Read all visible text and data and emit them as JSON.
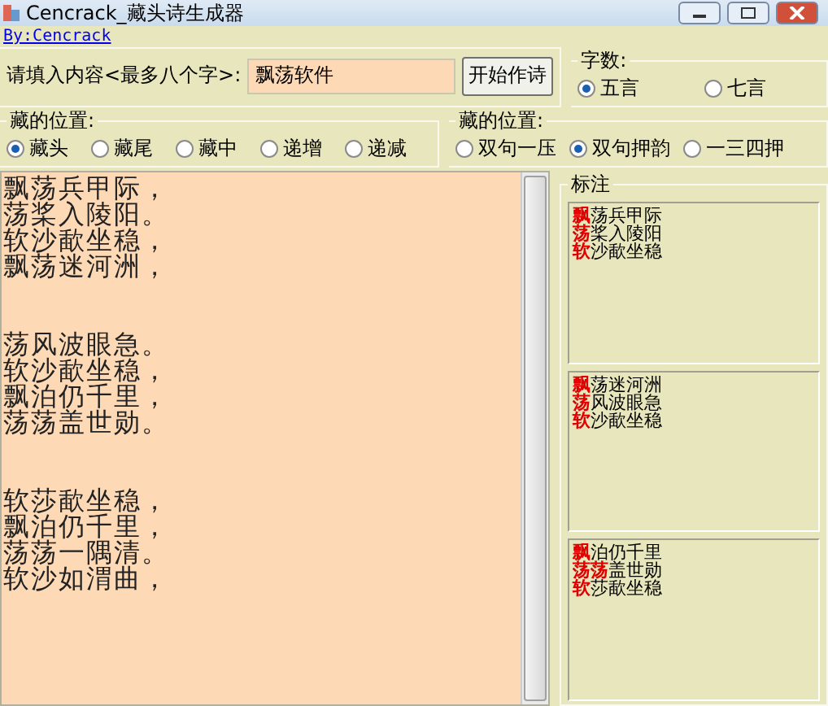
{
  "window": {
    "title": "Cencrack_藏头诗生成器"
  },
  "author_link": "By:Cencrack",
  "input": {
    "label": "请填入内容<最多八个字>:",
    "value": "飘荡软件",
    "button": "开始作诗"
  },
  "word_count": {
    "title": "字数:",
    "options": [
      {
        "label": "五言",
        "selected": true
      },
      {
        "label": "七言",
        "selected": false
      }
    ]
  },
  "position": {
    "title": "藏的位置:",
    "options": [
      {
        "label": "藏头",
        "selected": true
      },
      {
        "label": "藏尾",
        "selected": false
      },
      {
        "label": "藏中",
        "selected": false
      },
      {
        "label": "递增",
        "selected": false
      },
      {
        "label": "递减",
        "selected": false
      }
    ]
  },
  "rhyme": {
    "title": "藏的位置:",
    "options": [
      {
        "label": "双句一压",
        "selected": false
      },
      {
        "label": "双句押韵",
        "selected": true
      },
      {
        "label": "一三四押",
        "selected": false
      }
    ]
  },
  "poem": [
    [
      "飘荡兵甲际，",
      "荡桨入陵阳。",
      "软沙歃坐稳，",
      "飘荡迷河洲，"
    ],
    [
      "荡风波眼急。",
      "软沙歃坐稳，",
      "飘泊仍千里，",
      "荡荡盖世勋。"
    ],
    [
      "软莎歃坐稳，",
      "飘泊仍千里，",
      "荡荡一隅清。",
      "软沙如渭曲，"
    ]
  ],
  "annotation": {
    "title": "标注",
    "boxes": [
      [
        {
          "mark": "飘",
          "rest": "荡兵甲际"
        },
        {
          "mark": "荡",
          "rest": "桨入陵阳"
        },
        {
          "mark": "软",
          "rest": "沙歃坐稳"
        }
      ],
      [
        {
          "mark": "飘",
          "rest": "荡迷河洲"
        },
        {
          "mark": "荡",
          "rest": "风波眼急"
        },
        {
          "mark": "软",
          "rest": "沙歃坐稳"
        }
      ],
      [
        {
          "mark": "飘",
          "rest": "泊仍千里"
        },
        {
          "mark": "荡荡",
          "rest": "盖世勋"
        },
        {
          "mark": "软",
          "rest": "莎歃坐稳"
        }
      ]
    ]
  }
}
